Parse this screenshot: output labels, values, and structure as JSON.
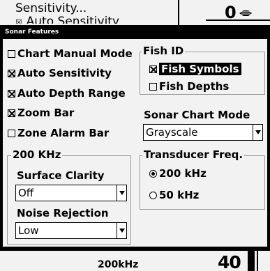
{
  "background": {
    "menu_item_1": "Sensitivity...",
    "menu_item_2_check": "☒",
    "menu_item_2": "Auto Sensitivity",
    "depth_readout": "0"
  },
  "dialog": {
    "title": "Sonar Features",
    "left_checkboxes": [
      {
        "label": "Chart Manual Mode",
        "checked": false
      },
      {
        "label": "Auto Sensitivity",
        "checked": true
      },
      {
        "label": "Auto Depth Range",
        "checked": true
      },
      {
        "label": "Zoom Bar",
        "checked": true
      },
      {
        "label": "Zone Alarm Bar",
        "checked": false
      }
    ],
    "group_200khz": {
      "title": "200 KHz",
      "surface_clarity_label": "Surface Clarity",
      "surface_clarity_value": "Off",
      "noise_rejection_label": "Noise Rejection",
      "noise_rejection_value": "Low"
    },
    "fish_id": {
      "title": "Fish ID",
      "items": [
        {
          "label": "Fish Symbols",
          "checked": true
        },
        {
          "label": "Fish Depths",
          "checked": false
        }
      ]
    },
    "sonar_chart_mode": {
      "label": "Sonar Chart Mode",
      "value": "Grayscale"
    },
    "transducer": {
      "title": "Transducer Freq.",
      "options": [
        {
          "label": "200 kHz",
          "selected": true
        },
        {
          "label": "50 kHz",
          "selected": false
        }
      ]
    }
  },
  "status": {
    "frequency": "200kHz",
    "depth": "40"
  }
}
